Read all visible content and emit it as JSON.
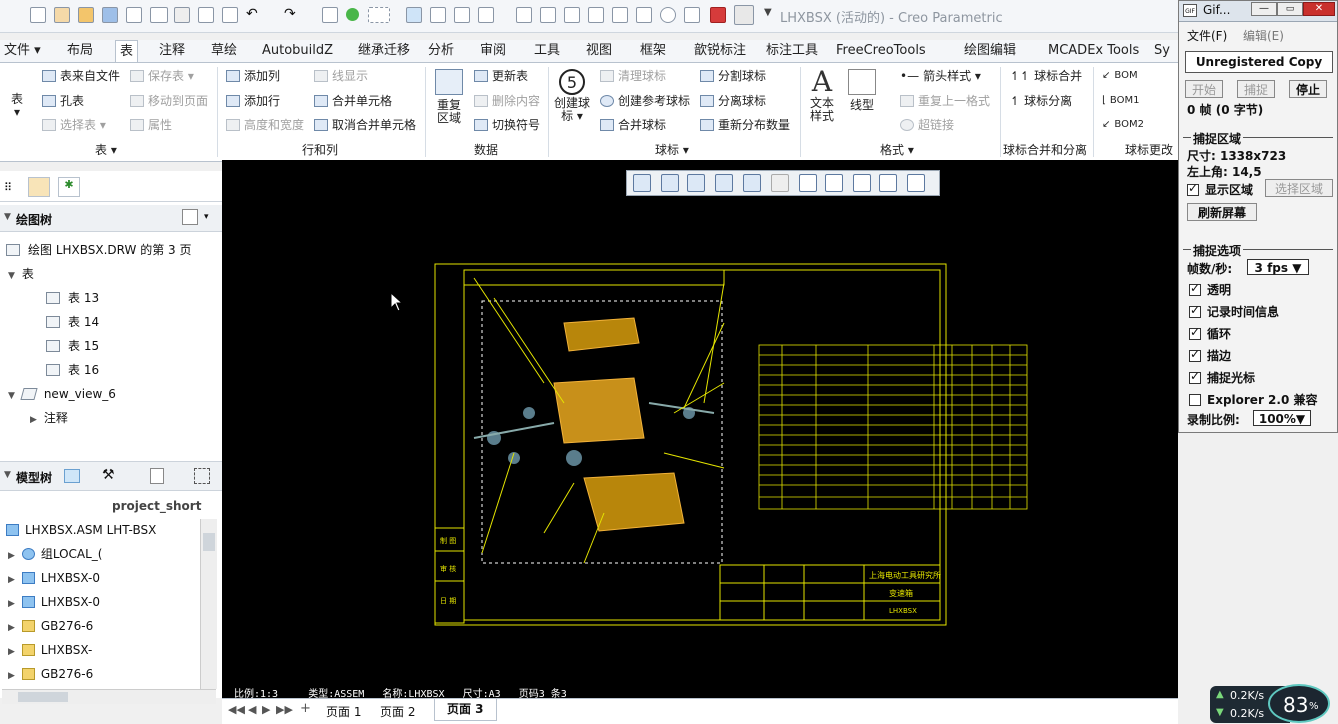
{
  "app": {
    "title": "LHXBSX (活动的) - Creo Parametric",
    "file_menu": "文件"
  },
  "tabs": [
    "布局",
    "表",
    "注释",
    "草绘",
    "AutobuildZ",
    "继承迁移",
    "分析",
    "审阅",
    "工具",
    "视图",
    "框架",
    "歆锐标注",
    "标注工具",
    "FreeCreoTools",
    "绘图编辑",
    "MCADEx Tools",
    "Sy"
  ],
  "ribbon": {
    "table_group": {
      "label": "表",
      "big": "表",
      "items": [
        "表来自文件",
        "孔表",
        "选择表",
        "保存表",
        "移动到页面",
        "属性"
      ]
    },
    "rows_cols": {
      "label": "行和列",
      "items": [
        "添加列",
        "添加行",
        "高度和宽度",
        "线显示",
        "合并单元格",
        "取消合并单元格"
      ]
    },
    "data": {
      "label": "数据",
      "big": "重复区域",
      "items": [
        "更新表",
        "删除内容",
        "切换符号"
      ]
    },
    "balloon": {
      "label": "球标",
      "big": "创建球标",
      "items": [
        "清理球标",
        "创建参考球标",
        "合并球标",
        "分割球标",
        "分离球标",
        "重新分布数量"
      ]
    },
    "format": {
      "label": "格式",
      "big1": "文本样式",
      "big2": "线型",
      "items": [
        "箭头样式",
        "重复上一格式",
        "超链接"
      ]
    },
    "merge_split": {
      "label": "球标合并和分离",
      "items": [
        "球标合并",
        "球标分离"
      ]
    },
    "change": {
      "label": "球标更改",
      "items": [
        "BOM",
        "BOM1",
        "BOM2"
      ]
    }
  },
  "drawing_tree": {
    "header": "绘图树",
    "root": "绘图 LHXBSX.DRW 的第 3 页",
    "table_node": "表",
    "tables": [
      "表 13",
      "表 14",
      "表 15",
      "表 16"
    ],
    "view": "new_view_6",
    "annotation": "注释"
  },
  "model_tree": {
    "header": "模型树",
    "column": "project_short",
    "root": "LHXBSX.ASM  LHT-BSX",
    "items": [
      "组LOCAL_(",
      "LHXBSX-0",
      "LHXBSX-0",
      "GB276-6",
      "LHXBSX-",
      "GB276-6"
    ]
  },
  "status": {
    "scale": "比例:1:3",
    "type": "类型:ASSEM",
    "name": "名称:LHXBSX",
    "size": "尺寸:A3",
    "page": "页码3 条3"
  },
  "pages": [
    "页面 1",
    "页面 2",
    "页面 3"
  ],
  "drawing": {
    "company": "上海电动工具研究所",
    "part_name": "变速箱",
    "code": "LHXBSX",
    "left_labels": [
      "制 图",
      "审 核",
      "日 期"
    ]
  },
  "gif_panel": {
    "title": "Gif...",
    "menus": [
      "文件(F)",
      "编辑(E)"
    ],
    "unregistered": "Unregistered Copy",
    "buttons": [
      "开始",
      "捕捉",
      "停止"
    ],
    "frames": "0 帧 (0 字节)",
    "area_section": "捕捉区域",
    "size": "尺寸: 1338x723",
    "topleft": "左上角: 14,5",
    "show_area": "显示区域",
    "select_area": "选择区域",
    "refresh": "刷新屏幕",
    "options_section": "捕捉选项",
    "fps_label": "帧数/秒:",
    "fps_value": "3 fps",
    "options": [
      {
        "label": "透明",
        "checked": true
      },
      {
        "label": "记录时间信息",
        "checked": true
      },
      {
        "label": "循环",
        "checked": true
      },
      {
        "label": "描边",
        "checked": true
      },
      {
        "label": "捕捉光标",
        "checked": true
      },
      {
        "label": "Explorer 2.0 兼容",
        "checked": false
      }
    ],
    "ratio_label": "录制比例:",
    "ratio_value": "100%"
  },
  "network": {
    "up": "0.2K/s",
    "down": "0.2K/s",
    "percent": "83",
    "percent_unit": "%"
  }
}
